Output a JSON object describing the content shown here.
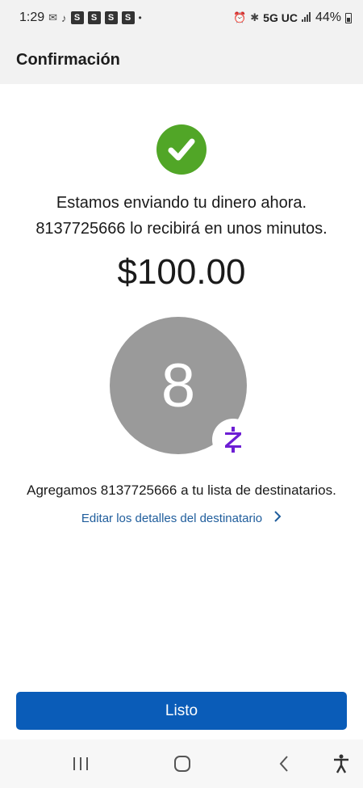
{
  "status_bar": {
    "time": "1:29",
    "network": "5G UC",
    "battery": "44%",
    "notif_boxes": [
      "S",
      "S",
      "S",
      "S"
    ]
  },
  "header": {
    "title": "Confirmación"
  },
  "confirmation": {
    "message_line1": "Estamos enviando tu dinero ahora.",
    "message_line2": "8137725666 lo recibirá en unos minutos.",
    "amount": "$100.00",
    "avatar_initial": "8",
    "badge_glyph": "Z",
    "added_text": "Agregamos 8137725666 a tu lista de destinatarios.",
    "edit_link": "Editar los detalles del destinatario"
  },
  "actions": {
    "done_label": "Listo"
  },
  "colors": {
    "success_green": "#51a627",
    "primary_blue": "#0a5cb8",
    "link_blue": "#1f5d9c",
    "zelle_purple": "#6d1ed4",
    "avatar_gray": "#9a9a9a"
  },
  "icons": {
    "check": "check-icon",
    "zelle": "zelle-logo-icon",
    "chevron": "chevron-right-icon",
    "nav_recents": "recents-icon",
    "nav_home": "home-icon",
    "nav_back": "back-icon",
    "nav_accessibility": "accessibility-icon"
  }
}
